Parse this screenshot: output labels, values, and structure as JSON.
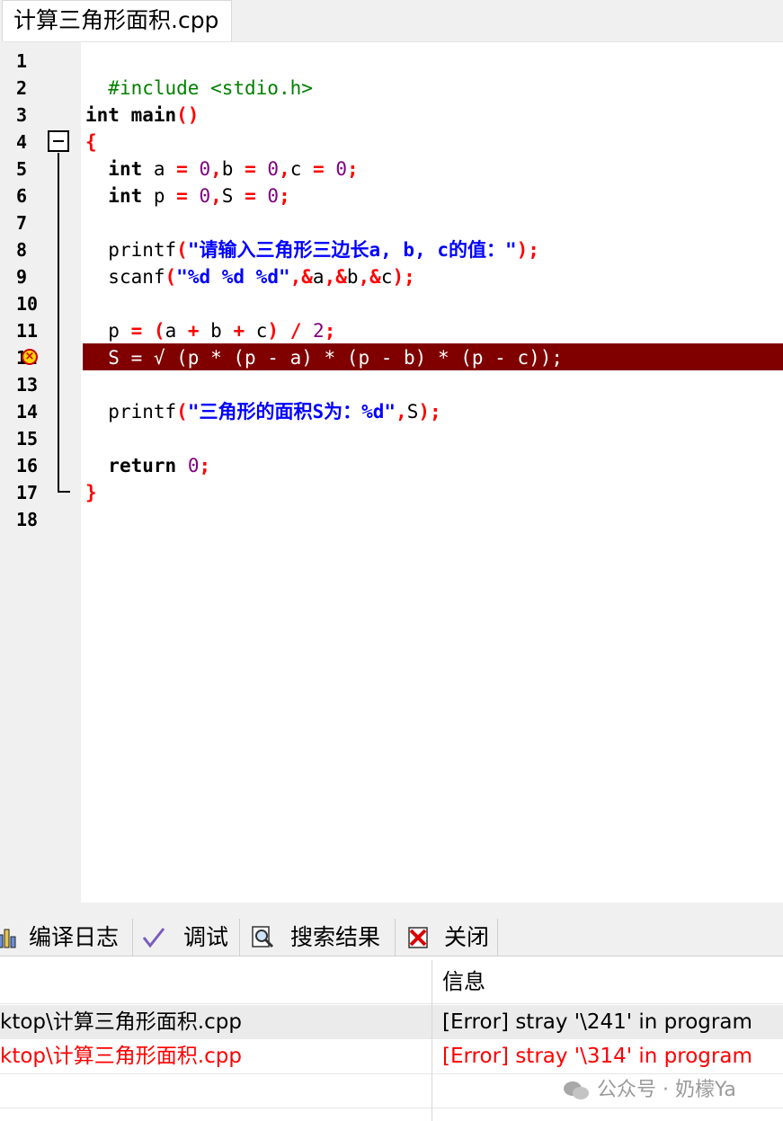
{
  "file_tab": {
    "title": "计算三角形面积.cpp"
  },
  "editor": {
    "line_numbers": [
      "1",
      "2",
      "3",
      "4",
      "5",
      "6",
      "7",
      "8",
      "9",
      "10",
      "11",
      "12",
      "13",
      "14",
      "15",
      "16",
      "17",
      "18"
    ],
    "error_line_number": "12",
    "lines": {
      "l1_pp": "#include <stdio.h>",
      "l3_kw": "int",
      "l3_rest": " main",
      "l3_paren": "()",
      "l4_brace": "{",
      "l5": {
        "kw": "int",
        "a": " a ",
        "eq1": "=",
        "sp1": " ",
        "z1": "0",
        "c1": ",",
        "b": "b ",
        "eq2": "=",
        "sp2": " ",
        "z2": "0",
        "c2": ",",
        "c": "c ",
        "eq3": "=",
        "sp3": " ",
        "z3": "0",
        "semi": ";"
      },
      "l6": {
        "kw": "int",
        "p": " p ",
        "eq1": "=",
        "sp1": " ",
        "z1": "0",
        "c1": ",",
        "s": "S ",
        "eq2": "=",
        "sp2": " ",
        "z2": "0",
        "semi": ";"
      },
      "l8": {
        "fn": "printf",
        "lp": "(",
        "str": "\"请输入三角形三边长a, b, c的值：\"",
        "rp": ");"
      },
      "l9": {
        "fn": "scanf",
        "lp": "(",
        "str": "\"%d %d %d\"",
        "c1": ",&",
        "a": "a",
        "c2": ",&",
        "b": "b",
        "c3": ",&",
        "c": "c",
        "rp": ");"
      },
      "l11": {
        "p": "p ",
        "eq": "=",
        "sp": " ",
        "lp": "(",
        "a": "a ",
        "plus1": "+",
        "b": " b ",
        "plus2": "+",
        "c": " c",
        "rp": ")",
        "sp2": " ",
        "div": "/",
        "sp3": " ",
        "two": "2",
        "semi": ";"
      },
      "l12_err": "S = √ (p * (p - a) * (p - b) * (p - c));",
      "l14": {
        "fn": "printf",
        "lp": "(",
        "str": "\"三角形的面积S为：%d\"",
        "c1": ",",
        "s": "S",
        "rp": ");"
      },
      "l16": {
        "kw": "return",
        "sp": " ",
        "z": "0",
        "semi": ";"
      },
      "l17_brace": "}"
    }
  },
  "bottom_tabs": [
    {
      "label": "编译日志",
      "icon": "bar-chart-icon"
    },
    {
      "label": "调试",
      "icon": "check-icon"
    },
    {
      "label": "搜索结果",
      "icon": "magnifier-icon"
    },
    {
      "label": "关闭",
      "icon": "close-x-icon"
    }
  ],
  "results": {
    "header_info": "信息",
    "rows": [
      {
        "file": "ktop\\计算三角形面积.cpp",
        "message": "[Error] stray '\\241' in program"
      },
      {
        "file": "ktop\\计算三角形面积.cpp",
        "message": "[Error] stray '\\314' in program"
      }
    ]
  },
  "watermark": {
    "text": "公众号 · 奶檬Ya"
  },
  "colors": {
    "error_line_bg": "#800000",
    "keyword": "#000000",
    "preprocessor": "#008000",
    "operator": "#ff0000",
    "number": "#800080",
    "string": "#0000ff",
    "error_text": "#ff0000"
  }
}
